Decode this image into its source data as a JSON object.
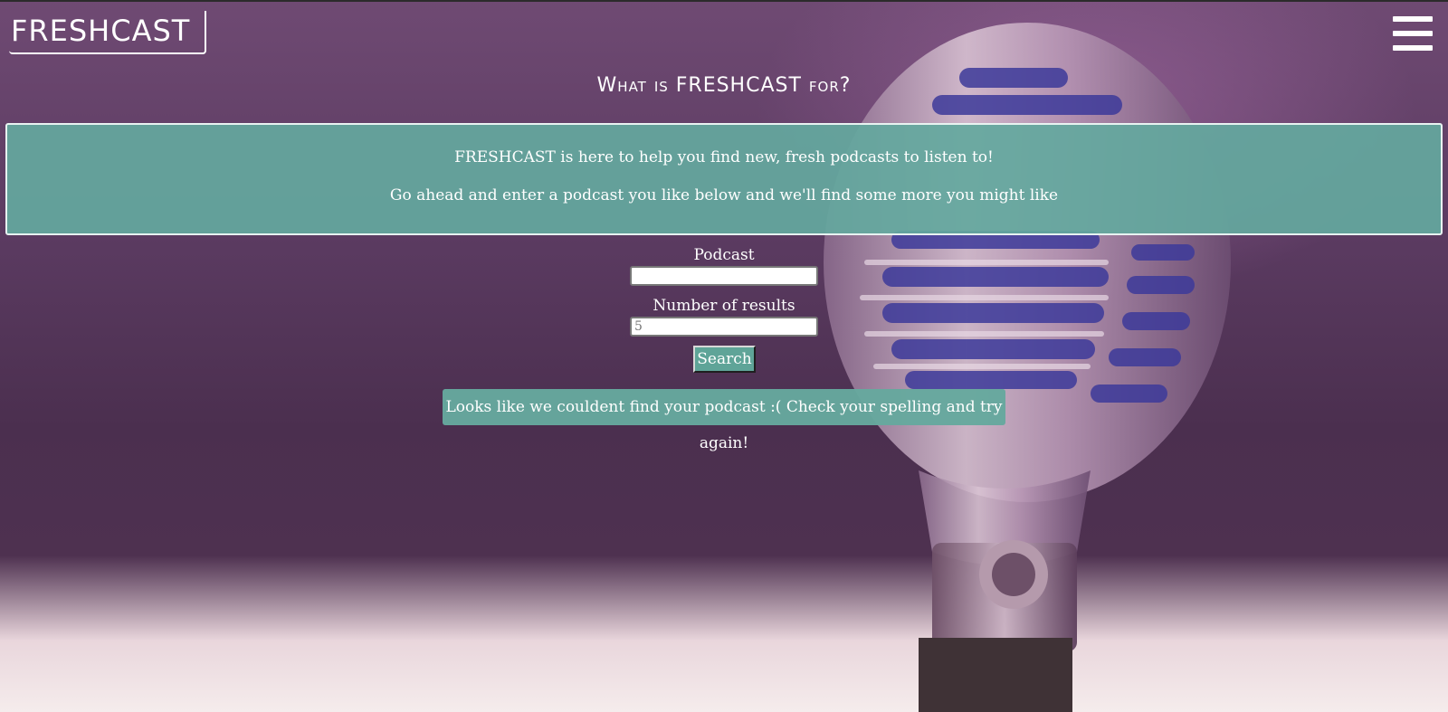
{
  "header": {
    "logo_text": "FRESHCAST",
    "menu_icon": "hamburger-menu-icon"
  },
  "main": {
    "title": "What is FRESHCAST for?",
    "info": {
      "line1": "FRESHCAST is here to help you find new, fresh podcasts to listen to!",
      "line2": "Go ahead and enter a podcast you like below and we'll find some more you might like"
    },
    "form": {
      "podcast_label": "Podcast",
      "podcast_value": "",
      "results_label": "Number of results",
      "results_placeholder": "5",
      "search_label": "Search"
    },
    "result_message": "Looks like we couldent find your podcast :( Check your spelling and try again!"
  },
  "colors": {
    "accent": "#64a89e",
    "text": "#ffffff"
  }
}
